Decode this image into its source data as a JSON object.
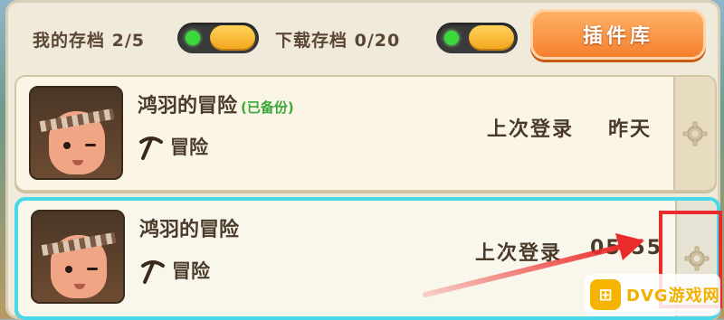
{
  "topbar": {
    "my_saves_label": "我的存档 2/5",
    "downloads_label": "下载存档 0/20",
    "plugin_button": "插件库"
  },
  "saves": [
    {
      "name": "鸿羽的冒险",
      "backup_tag": "(已备份)",
      "mode_label": "冒险",
      "last_login_label": "上次登录",
      "last_login_value": "昨天"
    },
    {
      "name": "鸿羽的冒险",
      "backup_tag": "",
      "mode_label": "冒险",
      "last_login_label": "上次登录",
      "last_login_value": "05:55"
    }
  ],
  "icons": {
    "toggle_on": "toggle-switch-icon",
    "settings": "gear-icon",
    "mode": "pickaxe-icon"
  },
  "watermark": {
    "text": "DVG游戏网"
  },
  "colors": {
    "accent_orange": "#f57c2a",
    "selected_border": "#48d8e8",
    "backup_green": "#3aa838",
    "annotation_red": "#ea2b2b"
  }
}
